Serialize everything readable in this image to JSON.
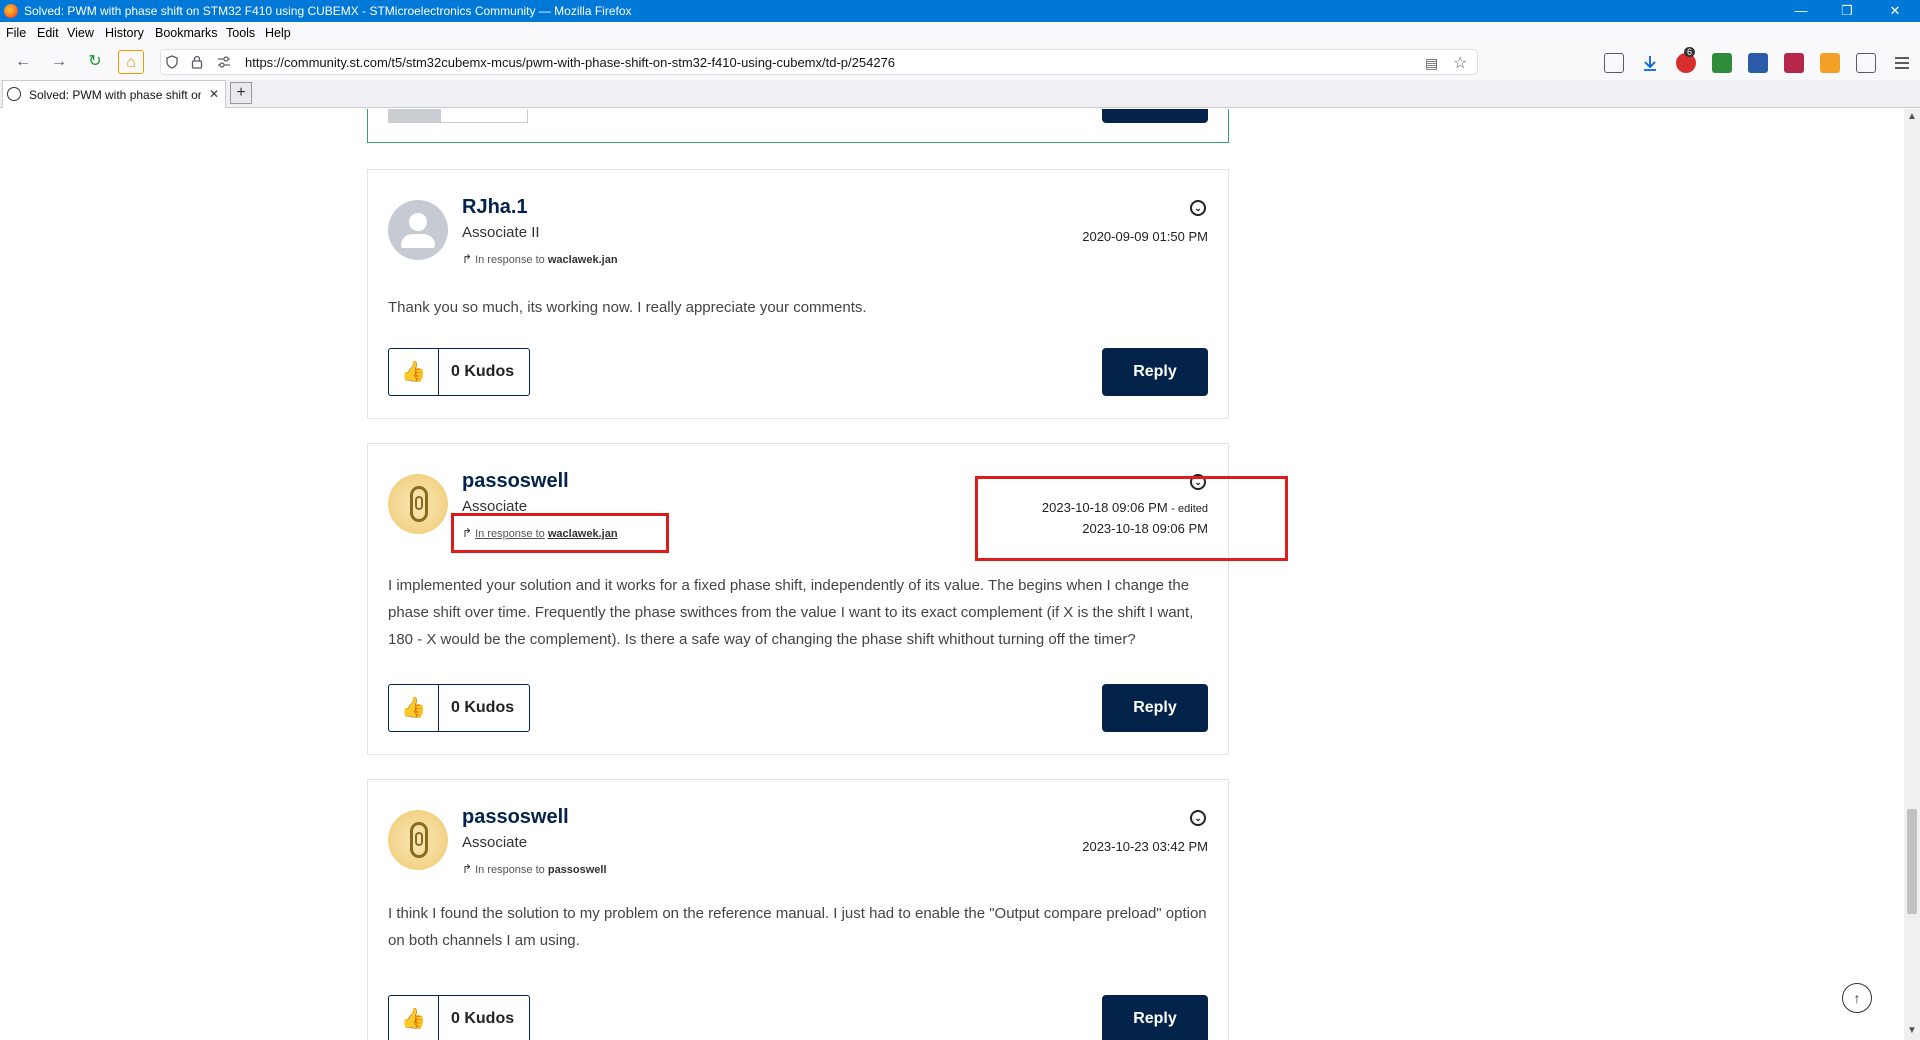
{
  "window": {
    "title": "Solved: PWM with phase shift on STM32 F410 using CUBEMX - STMicroelectronics Community — Mozilla Firefox",
    "minimize": "—",
    "restore": "❐",
    "close": "✕"
  },
  "menu": [
    "File",
    "Edit",
    "View",
    "History",
    "Bookmarks",
    "Tools",
    "Help"
  ],
  "nav": {
    "back": "←",
    "forward": "→",
    "reload": "↻",
    "home": "⌂",
    "url": "https://community.st.com/t5/stm32cubemx-mcus/pwm-with-phase-shift-on-stm32-f410-using-cubemx/td-p/254276",
    "reader": "▤",
    "bookmark_star": "☆",
    "download_badge": "6"
  },
  "tabs": [
    {
      "title": "Solved: PWM with phase shift on",
      "close": "✕"
    }
  ],
  "newtab_label": "+",
  "posts": [
    {
      "username": "RJha.1",
      "rank": "Associate II",
      "in_response_label": "In response to",
      "in_response_to": "waclawek.jan",
      "date": "2020-09-09 01:50 PM",
      "body": "Thank you so much, its working now. I really appreciate your comments.",
      "kudos": "0 Kudos",
      "reply": "Reply"
    },
    {
      "username": "passoswell",
      "rank": "Associate",
      "in_response_label": "In response to",
      "in_response_to": "waclawek.jan",
      "date_edited": "2023-10-18 09:06 PM",
      "edited_label": "- edited",
      "date": "2023-10-18 09:06 PM",
      "body": "I implemented your solution and it works for a fixed phase shift, independently of its value. The begins when I change the phase shift over time. Frequently the phase swithces from the value I want to its exact complement (if X is the shift I want, 180 - X would be the complement). Is there a safe way of changing the phase shift whithout turning off the timer?",
      "kudos": "0 Kudos",
      "reply": "Reply"
    },
    {
      "username": "passoswell",
      "rank": "Associate",
      "in_response_label": "In response to",
      "in_response_to": "passoswell",
      "date": "2023-10-23 03:42 PM",
      "body": "I think I found the solution to my problem on the reference manual. I just had to enable the \"Output compare preload\" option on both channels I am using.",
      "kudos": "0 Kudos",
      "reply": "Reply"
    }
  ],
  "colors": {
    "accent": "#03234b",
    "titlebar": "#0078d7",
    "annotation": "#e01b1b"
  }
}
